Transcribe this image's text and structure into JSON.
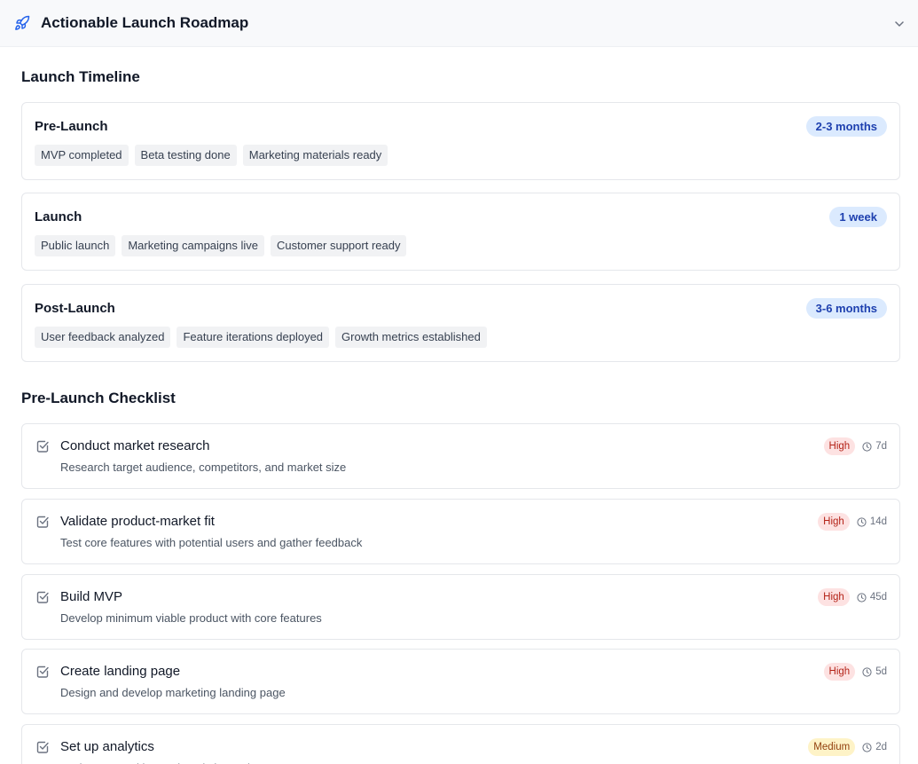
{
  "header": {
    "title": "Actionable Launch Roadmap",
    "icon": "rocket-icon",
    "toggle_icon": "chevron-down-icon",
    "accent_color": "#2563eb"
  },
  "timeline": {
    "title": "Launch Timeline",
    "phases": [
      {
        "name": "Pre-Launch",
        "duration": "2-3 months",
        "milestones": [
          "MVP completed",
          "Beta testing done",
          "Marketing materials ready"
        ]
      },
      {
        "name": "Launch",
        "duration": "1 week",
        "milestones": [
          "Public launch",
          "Marketing campaigns live",
          "Customer support ready"
        ]
      },
      {
        "name": "Post-Launch",
        "duration": "3-6 months",
        "milestones": [
          "User feedback analyzed",
          "Feature iterations deployed",
          "Growth metrics established"
        ]
      }
    ]
  },
  "checklist": {
    "title": "Pre-Launch Checklist",
    "tasks": [
      {
        "title": "Conduct market research",
        "description": "Research target audience, competitors, and market size",
        "priority": "High",
        "estimate": "7d"
      },
      {
        "title": "Validate product-market fit",
        "description": "Test core features with potential users and gather feedback",
        "priority": "High",
        "estimate": "14d"
      },
      {
        "title": "Build MVP",
        "description": "Develop minimum viable product with core features",
        "priority": "High",
        "estimate": "45d"
      },
      {
        "title": "Create landing page",
        "description": "Design and develop marketing landing page",
        "priority": "High",
        "estimate": "5d"
      },
      {
        "title": "Set up analytics",
        "description": "Implement tracking and analytics tools",
        "priority": "Medium",
        "estimate": "2d"
      }
    ]
  },
  "colors": {
    "duration_badge_bg": "#dbeafe",
    "duration_badge_text": "#1e40af",
    "priority_high_bg": "#fde2e2",
    "priority_high_text": "#b42318",
    "priority_medium_bg": "#fef3c7",
    "priority_medium_text": "#92400e"
  }
}
